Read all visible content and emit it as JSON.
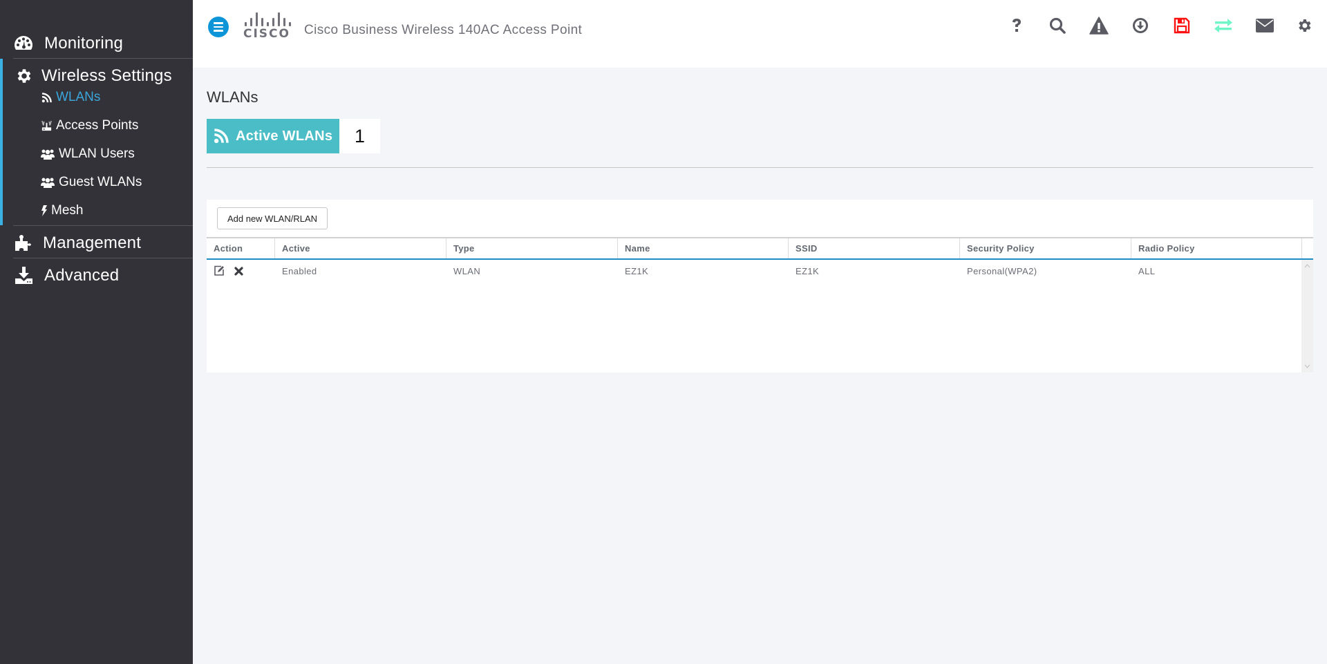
{
  "sidebar": {
    "main_items": [
      {
        "label": "Monitoring",
        "icon": "dashboard-icon"
      },
      {
        "label": "Wireless Settings",
        "icon": "gear-icon"
      },
      {
        "label": "Management",
        "icon": "puzzle-icon"
      },
      {
        "label": "Advanced",
        "icon": "download-icon"
      }
    ],
    "sub_items": [
      {
        "label": "WLANs",
        "icon": "rss-icon",
        "active": true
      },
      {
        "label": "Access Points",
        "icon": "access-point-icon"
      },
      {
        "label": "WLAN Users",
        "icon": "users-icon"
      },
      {
        "label": "Guest WLANs",
        "icon": "users-icon"
      },
      {
        "label": "Mesh",
        "icon": "bolt-icon"
      }
    ]
  },
  "header": {
    "logo_text": "CISCO",
    "title": "Cisco Business Wireless 140AC Access Point",
    "icons": [
      "help-icon",
      "search-icon",
      "alert-icon",
      "download-circle-icon",
      "save-icon",
      "swap-icon",
      "mail-icon",
      "settings-icon"
    ],
    "colors": {
      "default": "#5a5b62",
      "save": "#ff1010",
      "swap": "#6ff5c8",
      "menu": "#0e95d8"
    }
  },
  "page": {
    "title": "WLANs",
    "active_wlans": {
      "label": "Active WLANs",
      "count": "1",
      "color": "#4bbdc6"
    },
    "add_button": "Add new WLAN/RLAN"
  },
  "table": {
    "columns": [
      "Action",
      "Active",
      "Type",
      "Name",
      "SSID",
      "Security Policy",
      "Radio Policy"
    ],
    "rows": [
      {
        "actions": [
          "edit-icon",
          "delete-icon"
        ],
        "active": "Enabled",
        "type": "WLAN",
        "name": "EZ1K",
        "ssid": "EZ1K",
        "security_policy": "Personal(WPA2)",
        "radio_policy": "ALL"
      }
    ]
  }
}
